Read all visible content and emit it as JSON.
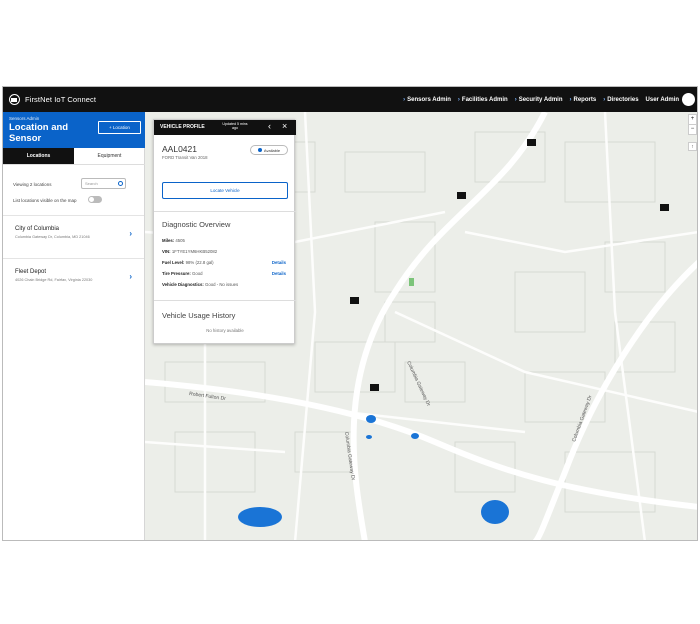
{
  "header": {
    "brand": "FirstNet IoT Connect",
    "nav": [
      "Sensors Admin",
      "Facilities Admin",
      "Security Admin",
      "Reports",
      "Directories",
      "User Admin"
    ]
  },
  "sidebar": {
    "breadcrumb": "Sensors Admin",
    "title": "Location and Sensor",
    "add_button": "+ Location",
    "tabs": [
      "Locations",
      "Equipment"
    ],
    "search_label": "Viewing 2 locations",
    "search_placeholder": "Search",
    "toggle_label": "List locations visible on the map",
    "locations": [
      {
        "name": "City of Columbia",
        "address": "Columbia Gateway Dr, Columbia, MD 21046"
      },
      {
        "name": "Fleet Depot",
        "address": "4026 Chain Bridge Rd, Fairfax, Virginia 22030"
      }
    ]
  },
  "vehicle": {
    "panel_title": "VEHICLE PROFILE",
    "updated": "Updated 5 mins ago",
    "id": "AAL0421",
    "model": "FORD Transit Van 2018",
    "status": "Available",
    "locate_button": "Locate Vehicle",
    "diagnostic_title": "Diagnostic Overview",
    "miles_label": "Miles:",
    "miles": "4505",
    "vin_label": "VIN:",
    "vin": "1FTYE1YM6HKB52082",
    "fuel_label": "Fuel Level:",
    "fuel": "98% (22.8 gal)",
    "tire_label": "Tire Pressure:",
    "tire": "Good",
    "diag_label": "Vehicle Diagnostics:",
    "diag": "Good - No issues",
    "details": "Details",
    "usage_title": "Vehicle Usage History",
    "no_history": "No history available"
  },
  "map": {
    "streets": [
      "Robert Fulton Dr",
      "Columbia Gateway Dr",
      "Columbia Gateway Dr",
      "Columbia Gateway Dr"
    ],
    "zoom_in": "+",
    "zoom_out": "−",
    "compass": "↑"
  },
  "colors": {
    "accent": "#0a63c9",
    "header": "#111111",
    "water": "#1a74d6",
    "park": "#7cc47a"
  }
}
